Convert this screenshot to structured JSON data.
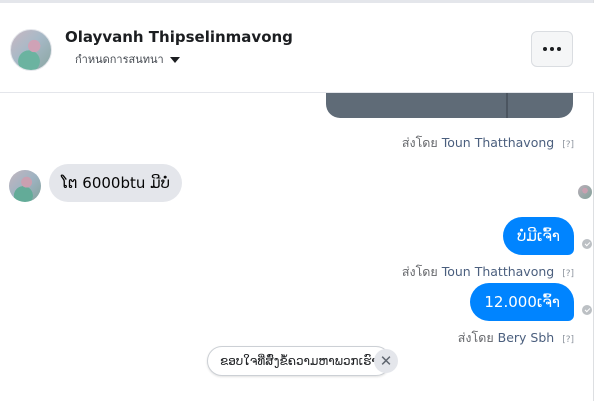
{
  "header": {
    "name": "Olayvanh Thipselinmavong",
    "subtitle": "กำหนดการสนทนา",
    "more_label": "•••"
  },
  "messages": [
    {
      "type": "outgoing-image",
      "sent_by_prefix": "ส่งโดย",
      "sent_by_name": "Toun Thatthavong",
      "help": "[?]"
    },
    {
      "type": "incoming",
      "text": "ໂຕ 6000btu ມີບໍ່"
    },
    {
      "type": "outgoing",
      "text": "ບໍ່ມີເຈົ້າ",
      "sent_by_prefix": "ส่งโดย",
      "sent_by_name": "Toun Thatthavong",
      "help": "[?]"
    },
    {
      "type": "outgoing",
      "text": "12.000ເຈົ້າ",
      "sent_by_prefix": "ส่งโดย",
      "sent_by_name": "Bery Sbh",
      "help": "[?]"
    }
  ],
  "quick_reply": {
    "text": "ຂອບໃຈທີ່ສົ່ງຂໍ້ຄວາມຫາພວກເຮົາ",
    "close_symbol": "✕"
  },
  "colors": {
    "outgoing_bubble": "#0084ff",
    "incoming_bubble": "#e4e6eb",
    "sender_name": "#4b5f7e"
  }
}
